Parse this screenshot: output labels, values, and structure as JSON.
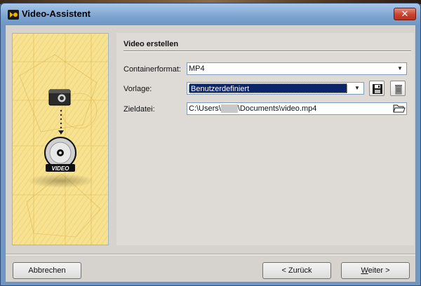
{
  "window": {
    "title": "Video-Assistent",
    "close_glyph": "✕"
  },
  "illustration": {
    "badge_text": "VIDEO"
  },
  "section": {
    "title": "Video erstellen"
  },
  "container_format": {
    "label": "Containerformat:",
    "value": "MP4"
  },
  "template": {
    "label": "Vorlage:",
    "value": "Benutzerdefiniert"
  },
  "target_file": {
    "label": "Zieldatei:",
    "path_prefix": "C:\\Users\\",
    "path_suffix": "\\Documents\\video.mp4"
  },
  "buttons": {
    "cancel": "Abbrechen",
    "back": "< Zurück",
    "next_prefix": "W",
    "next_rest": "eiter >"
  },
  "icons": [
    "app-logo-icon",
    "save-icon",
    "delete-icon",
    "folder-open-icon",
    "camera-icon",
    "disc-icon"
  ]
}
